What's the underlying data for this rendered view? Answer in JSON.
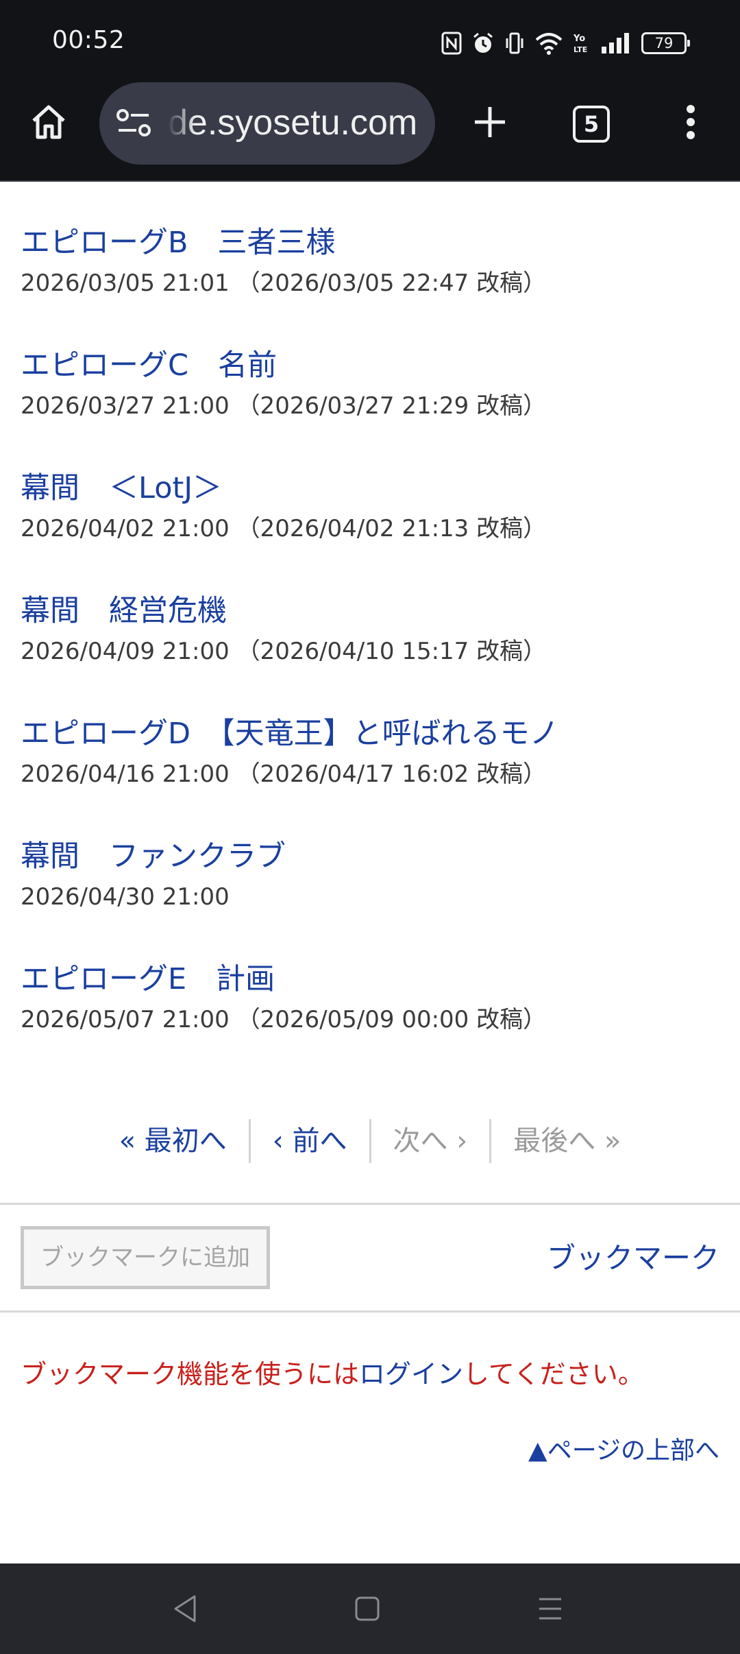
{
  "status_bar": {
    "time": "00:52",
    "battery": "79",
    "icons": [
      "nfc-icon",
      "alarm-icon",
      "vibrate-icon",
      "wifi-icon",
      "volte-icon",
      "signal-icon",
      "battery-icon"
    ]
  },
  "browser": {
    "url": "de.syosetu.com",
    "tab_count": "5",
    "icons": [
      "home-icon",
      "site-settings-icon",
      "plus-icon",
      "tab-switcher-icon",
      "more-vert-icon"
    ]
  },
  "episodes": [
    {
      "title": "エピローグB　三者三様",
      "date": "2026/03/05 21:01 （2026/03/05 22:47 改稿）"
    },
    {
      "title": "エピローグC　名前",
      "date": "2026/03/27 21:00 （2026/03/27 21:29 改稿）"
    },
    {
      "title": "幕間　＜LotJ＞",
      "date": "2026/04/02 21:00 （2026/04/02 21:13 改稿）"
    },
    {
      "title": "幕間　経営危機",
      "date": "2026/04/09 21:00 （2026/04/10 15:17 改稿）"
    },
    {
      "title": "エピローグD　【天竜王】と呼ばれるモノ",
      "date": "2026/04/16 21:00 （2026/04/17 16:02 改稿）"
    },
    {
      "title": "幕間　ファンクラブ",
      "date": "2026/04/30 21:00"
    },
    {
      "title": "エピローグE　計画",
      "date": "2026/05/07 21:00 （2026/05/09 00:00 改稿）"
    }
  ],
  "pager": {
    "first": "« 最初へ",
    "prev": "‹ 前へ",
    "next": "次へ ›",
    "last": "最後へ »"
  },
  "bookmark": {
    "add_button": "ブックマークに追加",
    "link": "ブックマーク"
  },
  "login_notice": {
    "before": "ブックマーク機能を使うには",
    "link": "ログイン",
    "after": "してください。"
  },
  "page_top": "▲ページの上部へ",
  "colors": {
    "link": "#1a3f9f",
    "notice_red": "#c8201c",
    "toolbar_bg": "#121317",
    "url_pill_bg": "#393c48",
    "nav_bar_bg": "#26272d"
  },
  "nav_bar": [
    "back-icon",
    "home-square-icon",
    "recents-icon"
  ]
}
